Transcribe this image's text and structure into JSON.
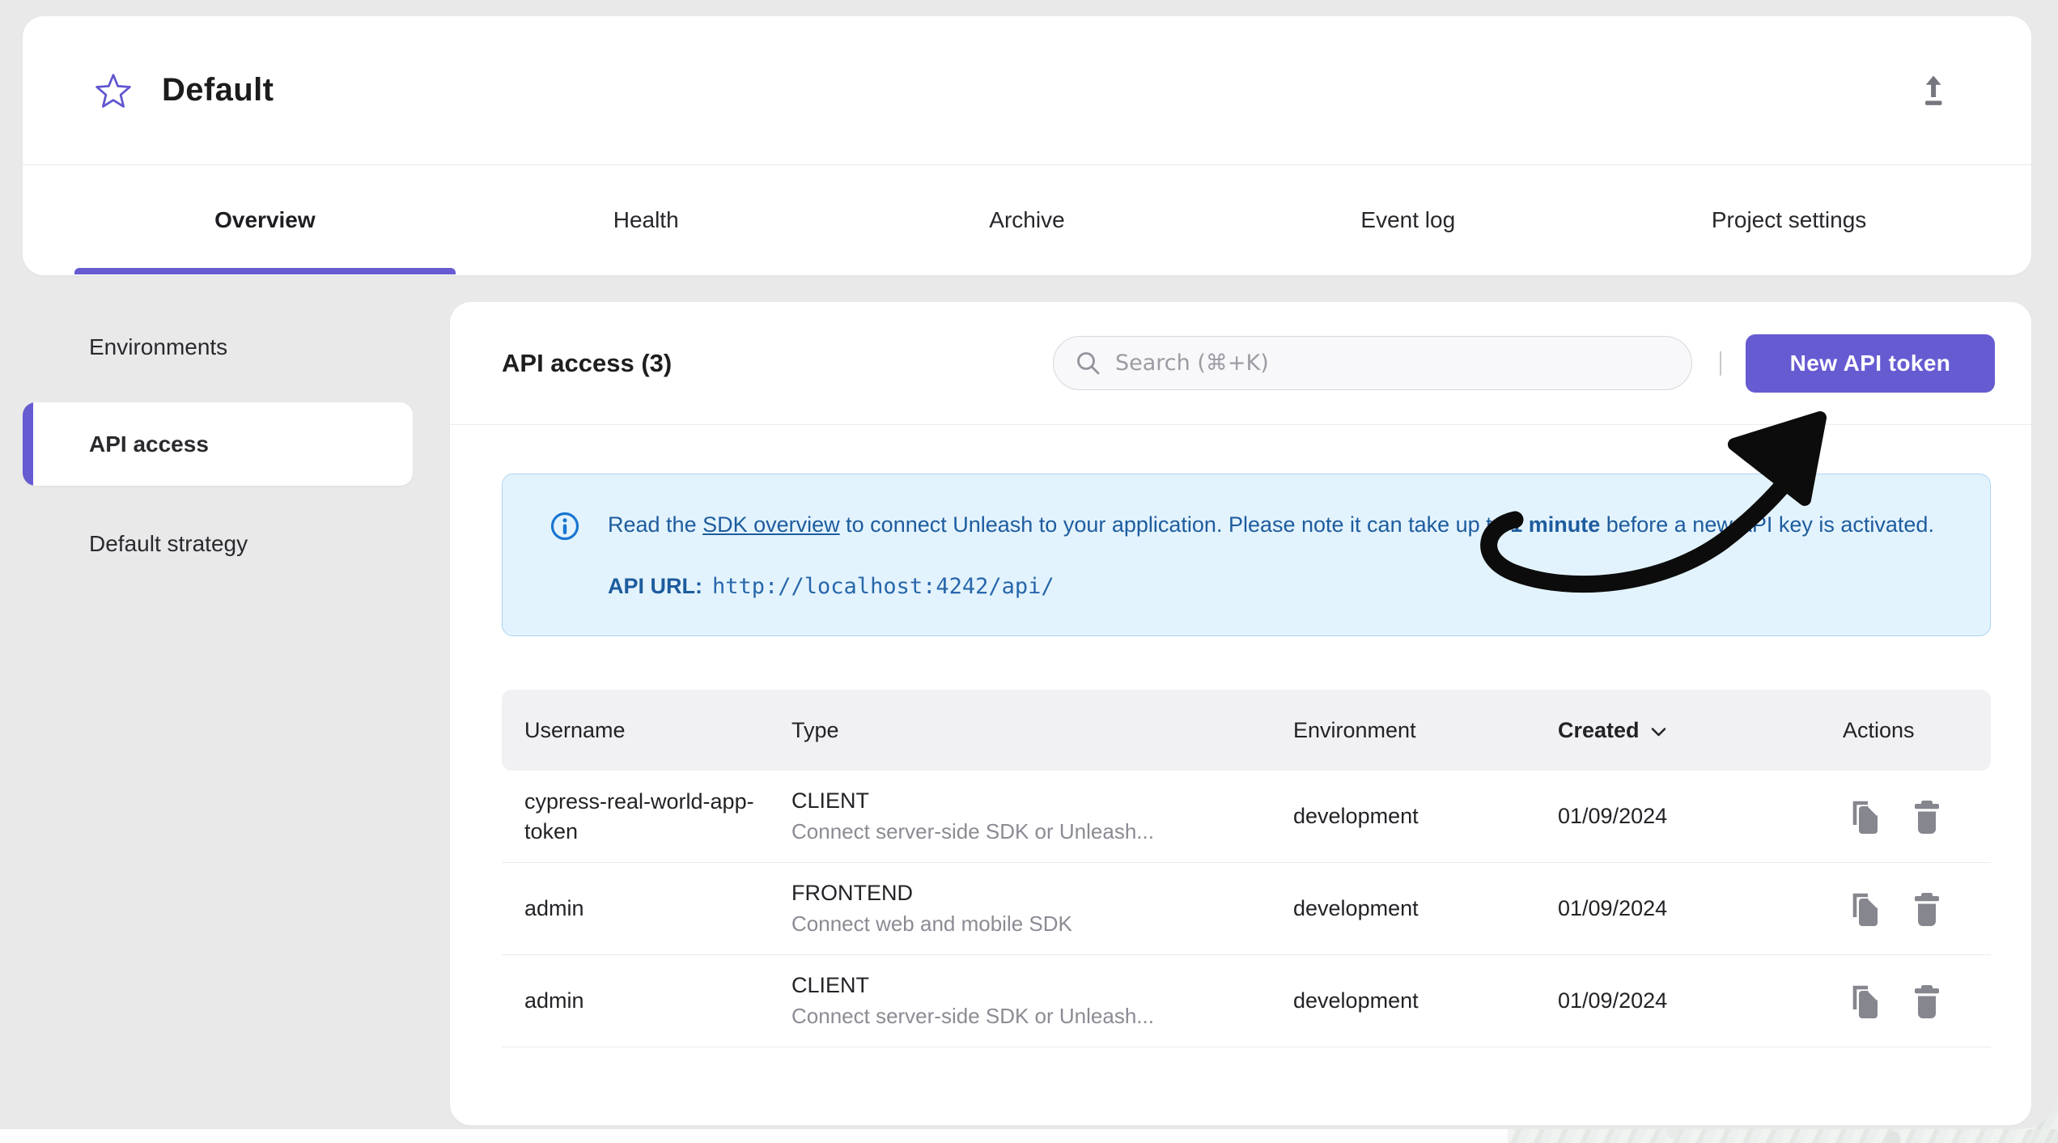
{
  "header": {
    "project_name": "Default"
  },
  "tabs": [
    {
      "label": "Overview",
      "active": true
    },
    {
      "label": "Health",
      "active": false
    },
    {
      "label": "Archive",
      "active": false
    },
    {
      "label": "Event log",
      "active": false
    },
    {
      "label": "Project settings",
      "active": false
    }
  ],
  "sidebar": {
    "items": [
      {
        "label": "Environments",
        "active": false
      },
      {
        "label": "API access",
        "active": true
      },
      {
        "label": "Default strategy",
        "active": false
      }
    ]
  },
  "main": {
    "title": "API access (3)",
    "search": {
      "placeholder": "Search (⌘+K)"
    },
    "new_token_button": "New API token",
    "alert": {
      "text_before_link": "Read the ",
      "link": "SDK overview",
      "text_after_link": " to connect Unleash to your application. Please note it can take up to ",
      "bold": "1 minute",
      "text_end": " before a new API key is activated.",
      "api_url_label": "API URL:",
      "api_url": "http://localhost:4242/api/"
    },
    "table": {
      "headers": [
        "Username",
        "Type",
        "Environment",
        "Created",
        "Actions"
      ],
      "sorted_by": "Created",
      "rows": [
        {
          "username": "cypress-real-world-app-token",
          "type": "CLIENT",
          "type_description": "Connect server-side SDK or Unleash...",
          "environment": "development",
          "created": "01/09/2024"
        },
        {
          "username": "admin",
          "type": "FRONTEND",
          "type_description": "Connect web and mobile SDK",
          "environment": "development",
          "created": "01/09/2024"
        },
        {
          "username": "admin",
          "type": "CLIENT",
          "type_description": "Connect server-side SDK or Unleash...",
          "environment": "development",
          "created": "01/09/2024"
        }
      ]
    }
  },
  "colors": {
    "accent_purple": "#675BD2",
    "alert_background": "#e3f3fd",
    "alert_text": "#1d5c9e",
    "info_icon_blue": "#1976d2",
    "action_icon_gray": "#86868f",
    "desktop_background": "#e9e9ea"
  }
}
